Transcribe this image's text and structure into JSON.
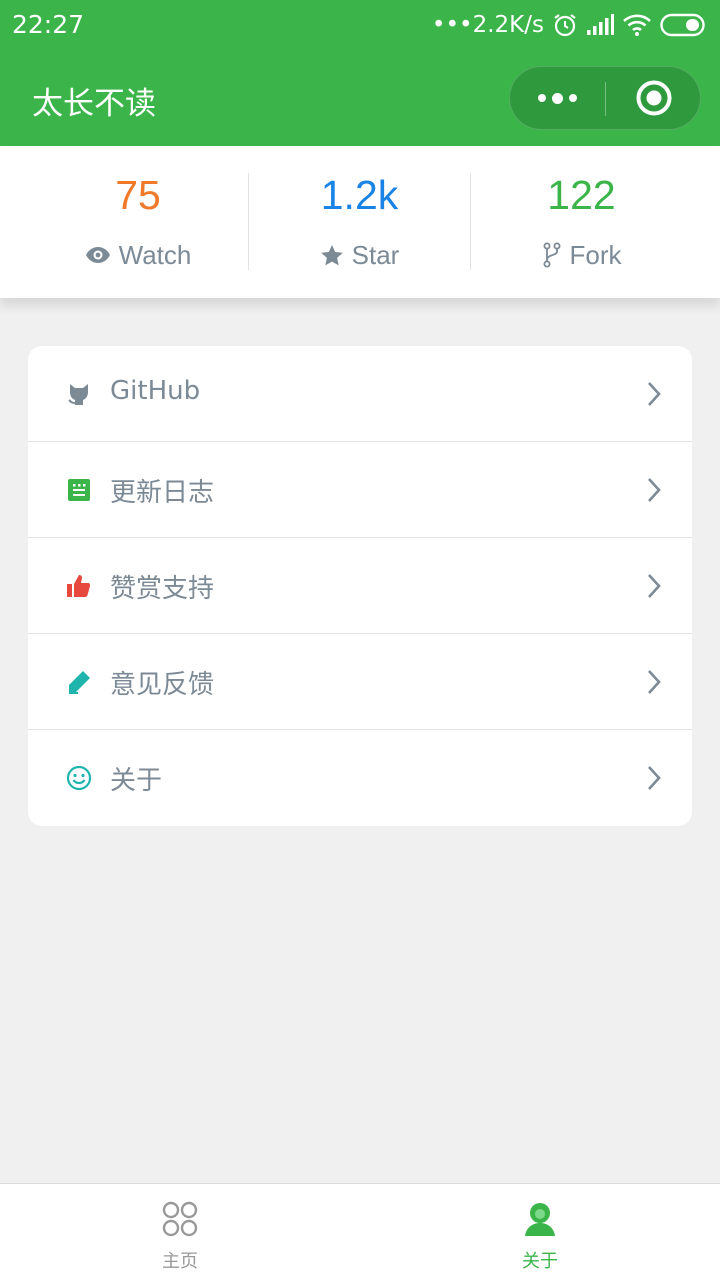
{
  "status_bar": {
    "time": "22:27",
    "network_speed": "•••2.2K/s",
    "icons": [
      "alarm-icon",
      "signal-icon",
      "wifi-icon",
      "battery-icon"
    ]
  },
  "header": {
    "title": "太长不读",
    "capsule_icons": [
      "more-dots-icon",
      "close-target-icon"
    ]
  },
  "stats": [
    {
      "value": "75",
      "label": "Watch",
      "icon": "eye-icon",
      "color": "#f07a2a"
    },
    {
      "value": "1.2k",
      "label": "Star",
      "icon": "star-icon",
      "color": "#1a84e6"
    },
    {
      "value": "122",
      "label": "Fork",
      "icon": "fork-icon",
      "color": "#3bb54a"
    }
  ],
  "menu": [
    {
      "label": "GitHub",
      "icon": "github-icon",
      "color": "#7c8a96"
    },
    {
      "label": "更新日志",
      "icon": "changelog-icon",
      "color": "#3bb54a"
    },
    {
      "label": "赞赏支持",
      "icon": "thumbs-up-icon",
      "color": "#e8493f"
    },
    {
      "label": "意见反馈",
      "icon": "pencil-icon",
      "color": "#1fb5ad"
    },
    {
      "label": "关于",
      "icon": "smile-icon",
      "color": "#1fb5ad"
    }
  ],
  "tabbar": [
    {
      "label": "主页",
      "icon": "home-grid-icon",
      "active": false
    },
    {
      "label": "关于",
      "icon": "user-icon",
      "active": true
    }
  ],
  "colors": {
    "brand": "#3bb54a",
    "background": "#f0f0f0",
    "text_muted": "#7c8a96",
    "tab_inactive": "#999999"
  }
}
